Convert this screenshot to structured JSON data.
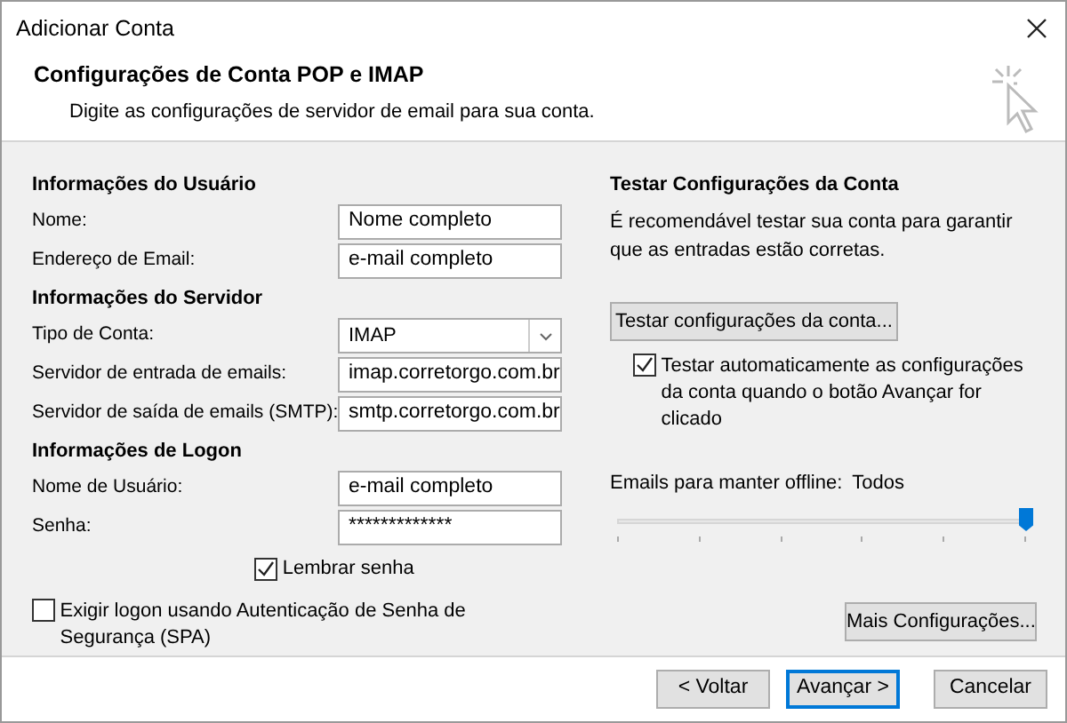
{
  "window": {
    "title": "Adicionar Conta"
  },
  "header": {
    "title": "Configurações de Conta POP e IMAP",
    "subtitle": "Digite as configurações de servidor de email para sua conta."
  },
  "left": {
    "sections": [
      {
        "heading": "Informações do Usuário",
        "fields": [
          {
            "label": "Nome:",
            "value": "Nome completo",
            "kind": "text"
          },
          {
            "label": "Endereço de Email:",
            "value": "e-mail completo",
            "kind": "text"
          }
        ]
      },
      {
        "heading": "Informações do Servidor",
        "fields": [
          {
            "label": "Tipo de Conta:",
            "value": "IMAP",
            "kind": "select"
          },
          {
            "label": "Servidor de entrada de emails:",
            "value": "imap.corretorgo.com.br",
            "kind": "text"
          },
          {
            "label": "Servidor de saída de emails (SMTP):",
            "value": "smtp.corretorgo.com.br",
            "kind": "text"
          }
        ]
      },
      {
        "heading": "Informações de Logon",
        "fields": [
          {
            "label": "Nome de Usuário:",
            "value": "e-mail completo",
            "kind": "text"
          },
          {
            "label": "Senha:",
            "value": "*************",
            "kind": "text"
          }
        ]
      }
    ],
    "remember_password": {
      "label": "Lembrar senha",
      "checked": true
    },
    "spa": {
      "label": "Exigir logon usando Autenticação de Senha de Segurança (SPA)",
      "checked": false
    }
  },
  "right": {
    "heading": "Testar Configurações da Conta",
    "description": "É recomendável testar sua conta para garantir que as entradas estão corretas.",
    "test_button": "Testar configurações da conta...",
    "auto_test": {
      "label": "Testar automaticamente as configurações da conta quando o botão Avançar for clicado",
      "checked": true
    },
    "offline": {
      "label": "Emails para manter offline:",
      "value": "Todos",
      "level": 1.0
    },
    "more_button": "Mais Configurações..."
  },
  "buttons": [
    {
      "label": "< Voltar",
      "default": false
    },
    {
      "label": "Avançar >",
      "default": true
    },
    {
      "label": "Cancelar",
      "default": false
    }
  ]
}
